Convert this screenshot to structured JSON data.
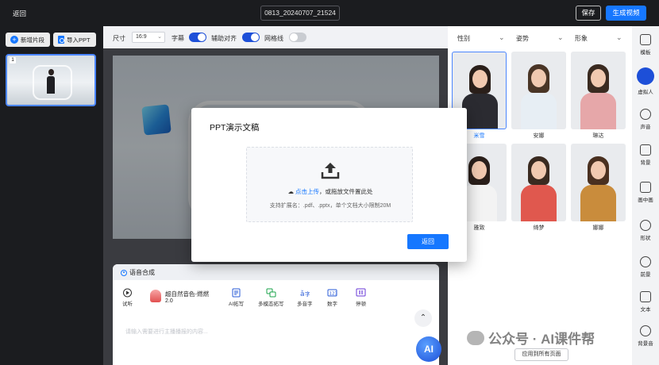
{
  "topbar": {
    "back_label": "返回",
    "filename": "0813_20240707_21524",
    "save_label": "保存",
    "generate_label": "生成视频"
  },
  "left_panel": {
    "add_segment_label": "新增片段",
    "import_ppt_label": "导入PPT",
    "slides": [
      {
        "number": "1"
      }
    ]
  },
  "toolbar": {
    "size_label": "尺寸",
    "ratio_value": "16:9",
    "subtitle_label": "字幕",
    "subtitle_on": true,
    "align_label": "辅助对齐",
    "align_on": true,
    "grid_label": "网格线",
    "grid_on": false
  },
  "tts": {
    "tab_label": "语音合成",
    "tools": [
      {
        "label": "试听",
        "icon": "play-icon"
      },
      {
        "label": "AI拓写",
        "icon": "ai-expand-icon"
      },
      {
        "label": "多模态拓写",
        "icon": "multimodal-icon"
      },
      {
        "label": "多音字",
        "icon": "polyphone-icon"
      },
      {
        "label": "数字",
        "icon": "number-icon"
      },
      {
        "label": "停顿",
        "icon": "pause-icon"
      }
    ],
    "voice_name": "超自然音色-燃燃",
    "voice_version": "2.0",
    "placeholder": "请输入需要进行主播播报的内容...",
    "ai_label": "AI"
  },
  "right_panel": {
    "filters": [
      "性别",
      "姿势",
      "形象"
    ],
    "avatars": [
      {
        "name": "米雪",
        "selected": true
      },
      {
        "name": "安娜",
        "selected": false
      },
      {
        "name": "琳达",
        "selected": false
      },
      {
        "name": "雅致",
        "selected": false
      },
      {
        "name": "绮梦",
        "selected": false
      },
      {
        "name": "娜娜",
        "selected": false
      }
    ],
    "apply_all_label": "应用到所有页面",
    "watermark": "公众号 · AI课件帮"
  },
  "side_menu": {
    "items": [
      {
        "label": "模板",
        "icon": "template-icon"
      },
      {
        "label": "虚拟人",
        "icon": "avatar-icon",
        "active": true
      },
      {
        "label": "声音",
        "icon": "sound-icon"
      },
      {
        "label": "背景",
        "icon": "background-icon"
      },
      {
        "label": "画中画",
        "icon": "pip-icon"
      },
      {
        "label": "形状",
        "icon": "shape-icon"
      },
      {
        "label": "前景",
        "icon": "foreground-icon"
      },
      {
        "label": "文本",
        "icon": "text-icon"
      },
      {
        "label": "背景音",
        "icon": "music-icon"
      }
    ]
  },
  "modal": {
    "title": "PPT演示文稿",
    "upload_link": "点击上传",
    "upload_hint": "，或拖放文件置此处",
    "upload_formats": "支持扩展名：.pdf、.pptx，单个文档大小限制20M",
    "return_label": "返回"
  },
  "colors": {
    "accent": "#1677ff",
    "dark_bg": "#1b1c1f",
    "toggle_on": "#1d4fd8"
  }
}
